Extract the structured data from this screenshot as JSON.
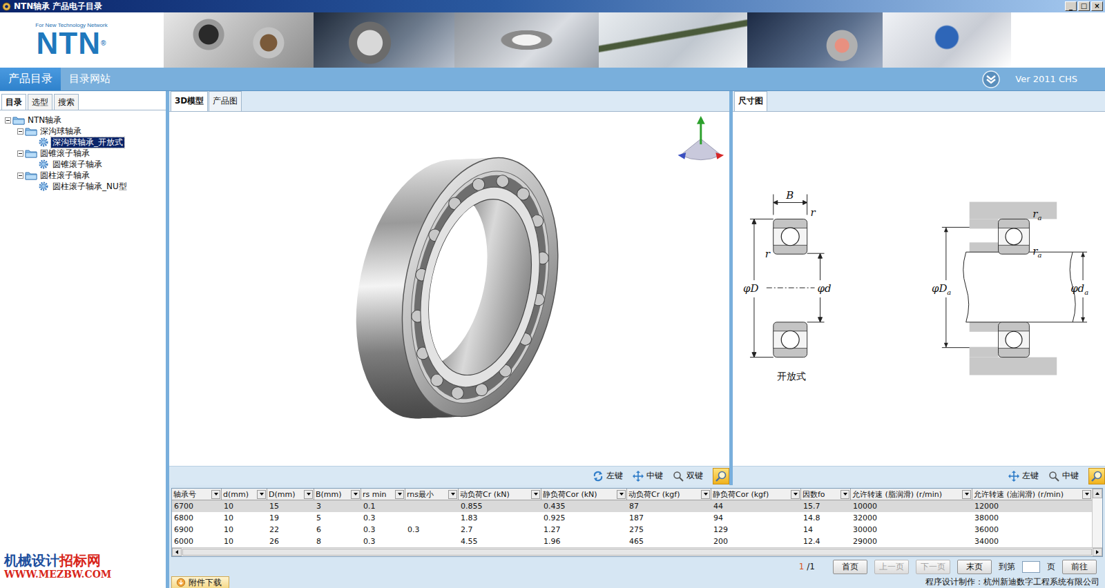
{
  "window": {
    "title": "NTN轴承 产品电子目录",
    "controls": [
      "_",
      "□",
      "×"
    ]
  },
  "logo": {
    "tagline": "For New Technology Network",
    "brand": "NTN",
    "mark": "®"
  },
  "nav": {
    "tabs": [
      {
        "label": "产品目录",
        "selected": true
      },
      {
        "label": "目录网站",
        "selected": false
      }
    ],
    "version": "Ver 2011 CHS"
  },
  "sidebar": {
    "tabs": [
      {
        "label": "目录",
        "selected": true
      },
      {
        "label": "选型",
        "selected": false
      },
      {
        "label": "搜索",
        "selected": false
      }
    ],
    "tree": [
      {
        "label": "NTN轴承",
        "level": 0,
        "kind": "folder",
        "expanded": true,
        "selected": false
      },
      {
        "label": "深沟球轴承",
        "level": 1,
        "kind": "folder",
        "expanded": true,
        "selected": false
      },
      {
        "label": "深沟球轴承_开放式",
        "level": 2,
        "kind": "item",
        "expanded": false,
        "selected": true
      },
      {
        "label": "圆锥滚子轴承",
        "level": 1,
        "kind": "folder",
        "expanded": true,
        "selected": false
      },
      {
        "label": "圆锥滚子轴承",
        "level": 2,
        "kind": "item",
        "expanded": false,
        "selected": false
      },
      {
        "label": "圆柱滚子轴承",
        "level": 1,
        "kind": "folder",
        "expanded": true,
        "selected": false
      },
      {
        "label": "圆柱滚子轴承_NU型",
        "level": 2,
        "kind": "item",
        "expanded": false,
        "selected": false
      }
    ]
  },
  "viewer": {
    "tabs": [
      {
        "label": "3D模型",
        "selected": true
      },
      {
        "label": "产品图",
        "selected": false
      }
    ],
    "tools": [
      {
        "label": "左键",
        "kind": "rotate"
      },
      {
        "label": "中键",
        "kind": "pan"
      },
      {
        "label": "双键",
        "kind": "zoom"
      }
    ]
  },
  "dimension": {
    "tabs": [
      {
        "label": "尺寸图",
        "selected": true
      }
    ],
    "left_labels": [
      {
        "text": "B",
        "sub": ""
      },
      {
        "text": "r",
        "sub": ""
      },
      {
        "text": "r",
        "sub": ""
      },
      {
        "text": "φD",
        "sub": ""
      },
      {
        "text": "φd",
        "sub": ""
      }
    ],
    "right_labels": [
      {
        "text": "r",
        "sub": "a"
      },
      {
        "text": "r",
        "sub": "a"
      },
      {
        "text": "φD",
        "sub": "a"
      },
      {
        "text": "φd",
        "sub": "a"
      }
    ],
    "caption": "开放式",
    "tools": [
      {
        "label": "左键",
        "kind": "pan"
      },
      {
        "label": "中键",
        "kind": "zoom"
      }
    ]
  },
  "table": {
    "columns": [
      "轴承号",
      "d(mm)",
      "D(mm)",
      "B(mm)",
      "rs min",
      "rns最小",
      "动负荷Cr (kN)",
      "静负荷Cor (kN)",
      "动负荷Cr (kgf)",
      "静负荷Cor (kgf)",
      "因数fo",
      "允许转速 (脂润滑) (r/min)",
      "允许转速 (油润滑) (r/min)"
    ],
    "rows": [
      {
        "cells": [
          "6700",
          "10",
          "15",
          "3",
          "0.1",
          "",
          "0.855",
          "0.435",
          "87",
          "44",
          "15.7",
          "10000",
          "12000"
        ],
        "selected": true
      },
      {
        "cells": [
          "6800",
          "10",
          "19",
          "5",
          "0.3",
          "",
          "1.83",
          "0.925",
          "187",
          "94",
          "14.8",
          "32000",
          "38000"
        ],
        "selected": false
      },
      {
        "cells": [
          "6900",
          "10",
          "22",
          "6",
          "0.3",
          "0.3",
          "2.7",
          "1.27",
          "275",
          "129",
          "14",
          "30000",
          "36000"
        ],
        "selected": false
      },
      {
        "cells": [
          "6000",
          "10",
          "26",
          "8",
          "0.3",
          "",
          "4.55",
          "1.96",
          "465",
          "200",
          "12.4",
          "29000",
          "34000"
        ],
        "selected": false
      }
    ]
  },
  "pager": {
    "current": "1",
    "total": "/1",
    "buttons": [
      {
        "label": "首页",
        "disabled": false
      },
      {
        "label": "上一页",
        "disabled": true
      },
      {
        "label": "下一页",
        "disabled": true
      },
      {
        "label": "末页",
        "disabled": false
      }
    ],
    "goto_prefix": "到第",
    "goto_suffix": "页",
    "go": "前往"
  },
  "attachment": {
    "label": "附件下载"
  },
  "watermark": {
    "parts": [
      {
        "text": "机械设计",
        "color": "#1d4f9e"
      },
      {
        "text": "招标网",
        "color": "#d8261b"
      }
    ],
    "url": "WWW.MEZBW.COM"
  },
  "footer": "程序设计制作：杭州新迪数字工程系统有限公司"
}
